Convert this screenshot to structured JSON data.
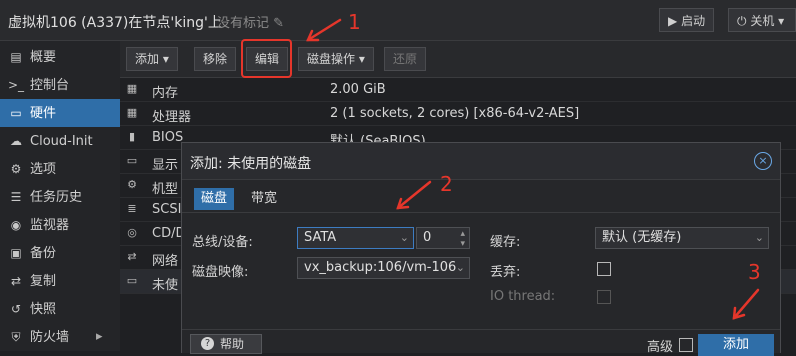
{
  "topbar": {
    "vm_title": "虚拟机106 (A337)在节点'king'上",
    "no_tag": "没有标记",
    "start_label": "启动",
    "shutdown_label": "关机"
  },
  "sidebar": {
    "items": [
      {
        "label": "概要",
        "icon": "book-icon"
      },
      {
        "label": "控制台",
        "icon": "terminal-icon"
      },
      {
        "label": "硬件",
        "icon": "monitor-icon",
        "active": true
      },
      {
        "label": "Cloud-Init",
        "icon": "cloud-icon"
      },
      {
        "label": "选项",
        "icon": "gear-icon"
      },
      {
        "label": "任务历史",
        "icon": "list-icon"
      },
      {
        "label": "监视器",
        "icon": "eye-icon"
      },
      {
        "label": "备份",
        "icon": "floppy-icon"
      },
      {
        "label": "复制",
        "icon": "retweet-icon"
      },
      {
        "label": "快照",
        "icon": "history-icon"
      },
      {
        "label": "防火墙",
        "icon": "shield-icon"
      }
    ]
  },
  "toolbar": {
    "add": "添加",
    "remove": "移除",
    "edit": "编辑",
    "disk_ops": "磁盘操作",
    "revert": "还原"
  },
  "hardware_rows": [
    {
      "key": "内存",
      "value": "2.00 GiB",
      "icon": "memory-icon"
    },
    {
      "key": "处理器",
      "value": "2 (1 sockets, 2 cores) [x86-64-v2-AES]",
      "icon": "cpu-icon"
    },
    {
      "key": "BIOS",
      "value": "默认 (SeaBIOS)",
      "icon": "chip-icon"
    },
    {
      "key": "显示",
      "value": "",
      "icon": "display-icon"
    },
    {
      "key": "机型",
      "value": "",
      "icon": "cogs-icon"
    },
    {
      "key": "SCSI",
      "value": "",
      "icon": "database-icon"
    },
    {
      "key": "CD/D",
      "value": "",
      "icon": "cdrom-icon"
    },
    {
      "key": "网络",
      "value": "",
      "icon": "exchange-icon"
    },
    {
      "key": "未使",
      "value": "",
      "icon": "hdd-icon"
    }
  ],
  "dialog": {
    "title": "添加: 未使用的磁盘",
    "tabs": [
      "磁盘",
      "带宽"
    ],
    "bus_label": "总线/设备:",
    "bus_value": "SATA",
    "device_value": "0",
    "image_label": "磁盘映像:",
    "image_value": "vx_backup:106/vm-106-",
    "cache_label": "缓存:",
    "cache_value": "默认 (无缓存)",
    "discard_label": "丢弃:",
    "io_label": "IO thread:",
    "help_label": "帮助",
    "advanced_label": "高级",
    "add_label": "添加"
  },
  "annotations": [
    "1",
    "2",
    "3"
  ],
  "colors": {
    "accent": "#2f6ea8",
    "annotation": "#e5362b"
  }
}
